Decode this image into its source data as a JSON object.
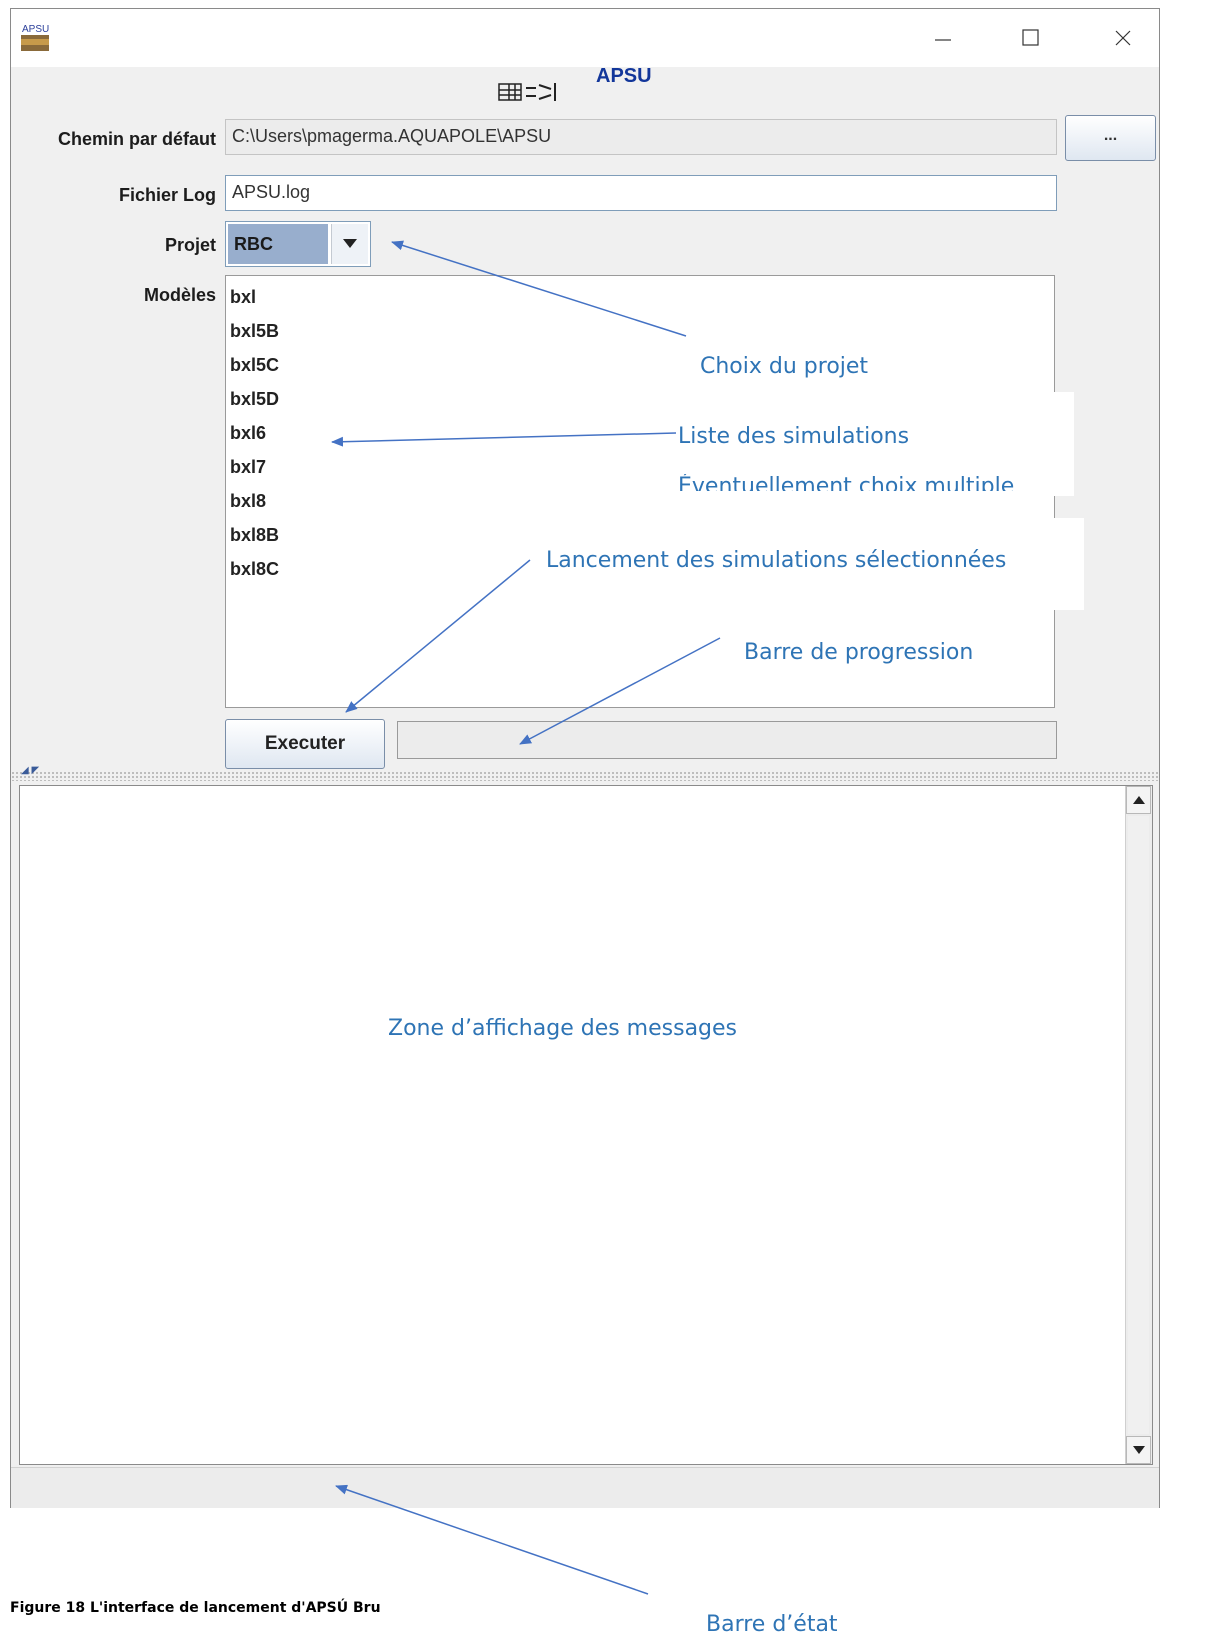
{
  "window": {
    "title_icon_text": "APSU",
    "header_title": "APSU",
    "controls": [
      "minimize",
      "maximize",
      "close"
    ]
  },
  "form": {
    "default_path_label": "Chemin par défaut",
    "default_path_value": "C:\\Users\\pmagerma.AQUAPOLE\\APSU",
    "browse_button_label": "...",
    "log_file_label": "Fichier Log",
    "log_file_value": "APSU.log",
    "project_label": "Projet",
    "project_value": "RBC",
    "models_label": "Modèles",
    "models": [
      "bxl",
      "bxl5B",
      "bxl5C",
      "bxl5D",
      "bxl6",
      "bxl7",
      "bxl8",
      "bxl8B",
      "bxl8C"
    ],
    "execute_button_label": "Executer",
    "progress": 0
  },
  "annotations": {
    "choix_projet": "Choix du projet",
    "liste_simulations": "Liste des simulations",
    "liste_simulations_sub": "Éventuellement choix multiple",
    "lancement": "Lancement des simulations  sélectionnées",
    "barre_progression": "Barre de progression",
    "zone_messages": "Zone d’affichage des messages",
    "barre_etat": "Barre d’état"
  },
  "caption": "Figure 18 L'interface de lancement d'APSÚ Bru",
  "colors": {
    "annotation": "#2e74b5",
    "header_title": "#12369a",
    "project_highlight": "#98aecd"
  }
}
